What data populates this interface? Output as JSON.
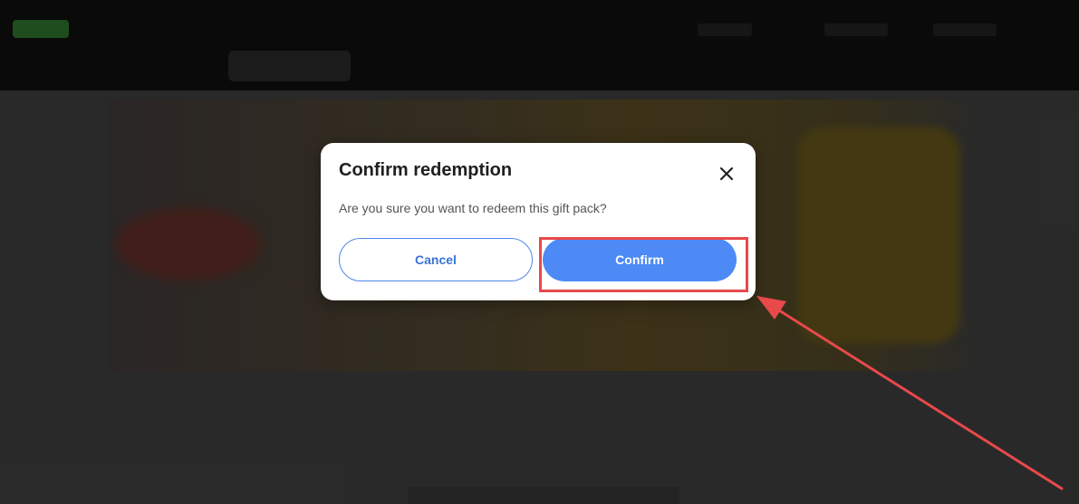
{
  "dialog": {
    "title": "Confirm redemption",
    "message": "Are you sure you want to redeem this gift pack?",
    "cancel_label": "Cancel",
    "confirm_label": "Confirm",
    "close_icon": "close-icon"
  },
  "colors": {
    "primary": "#4d8af5",
    "primary_text": "#3b73d8",
    "annotation": "#e8494b",
    "overlay": "#2f2f2f"
  }
}
